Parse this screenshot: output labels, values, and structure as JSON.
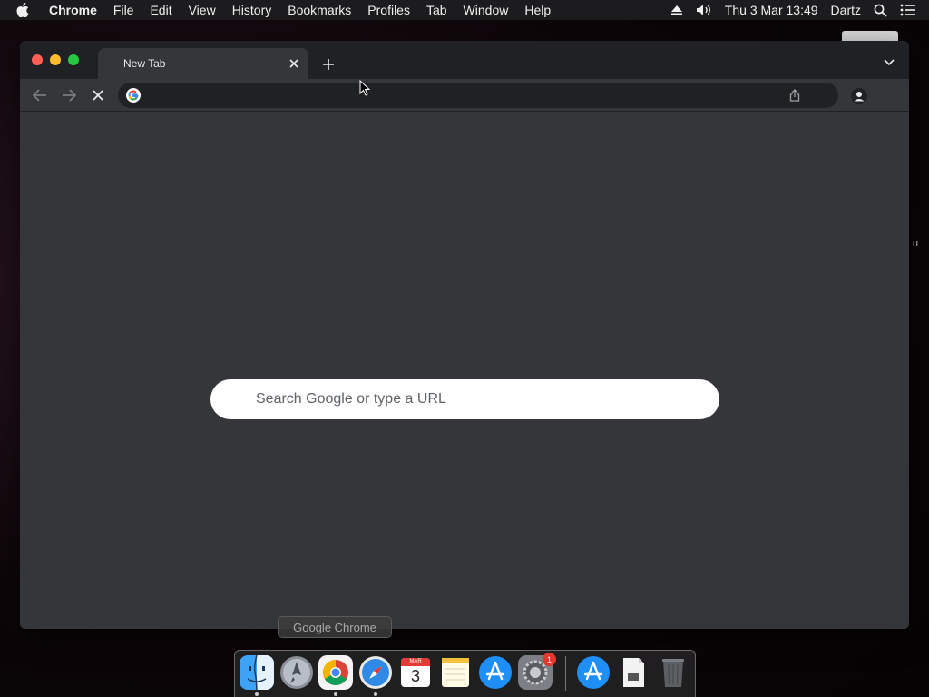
{
  "menubar": {
    "app_name": "Chrome",
    "items": [
      "File",
      "Edit",
      "View",
      "History",
      "Bookmarks",
      "Profiles",
      "Tab",
      "Window",
      "Help"
    ],
    "datetime": "Thu 3 Mar  13:49",
    "user": "Dartz"
  },
  "desktop": {
    "side_label": "n"
  },
  "browser": {
    "tab_title": "New Tab",
    "omnibox_value": "",
    "ntp_search_placeholder": "Search Google or type a URL"
  },
  "dock": {
    "tooltip": "Google Chrome",
    "apps": [
      "finder-icon",
      "launchpad-icon",
      "chrome-icon",
      "safari-icon",
      "calendar-icon",
      "notes-icon",
      "app-store-icon",
      "system-preferences-icon",
      "app-store-folder-icon",
      "document-icon",
      "trash-icon"
    ],
    "calendar_month": "MAR",
    "calendar_day": "3",
    "badge_count": "1"
  },
  "colors": {
    "window_bg": "#35363a",
    "tabstrip_bg": "#202124",
    "close_red": "#ff5f57",
    "min_yellow": "#febc2e",
    "max_green": "#28c840"
  }
}
